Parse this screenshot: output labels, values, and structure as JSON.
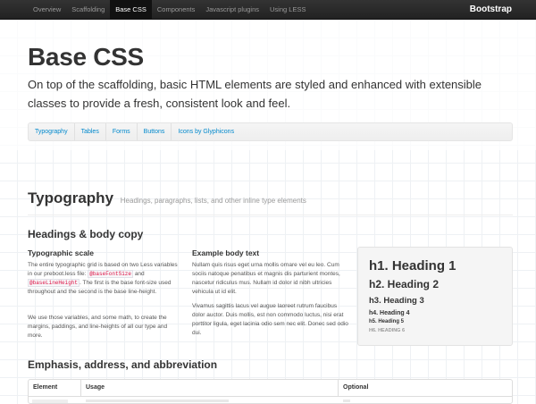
{
  "navbar": {
    "items": [
      "Overview",
      "Scaffolding",
      "Base CSS",
      "Components",
      "Javascript plugins",
      "Using LESS"
    ],
    "active_index": 2,
    "brand": "Bootstrap"
  },
  "header": {
    "title": "Base CSS",
    "lead": "On top of the scaffolding, basic HTML elements are styled and enhanced with extensible classes to provide a fresh, consistent look and feel."
  },
  "subnav": {
    "items": [
      "Typography",
      "Tables",
      "Forms",
      "Buttons",
      "Icons by Glyphicons"
    ]
  },
  "typography": {
    "title": "Typography",
    "subtitle": "Headings, paragraphs, lists, and other inline type elements",
    "headings_title": "Headings & body copy",
    "scale": {
      "title": "Typographic scale",
      "p1_before": "The entire typographic grid is based on two Less variables in our preboot.less file: ",
      "code1": "@baseFontSize",
      "p1_and": " and ",
      "code2": "@baseLineHeight",
      "p1_after": ". The first is the base font-size used throughout and the second is the base line-height.",
      "p2": "We use those variables, and some math, to create the margins, paddings, and line-heights of all our type and more."
    },
    "example": {
      "title": "Example body text",
      "p1": "Nullam quis risus eget urna mollis ornare vel eu leo. Cum sociis natoque penatibus et magnis dis parturient montes, nascetur ridiculus mus. Nullam id dolor id nibh ultricies vehicula ut id elit.",
      "p2": "Vivamus sagittis lacus vel augue laoreet rutrum faucibus dolor auctor. Duis mollis, est non commodo luctus, nisi erat porttitor ligula, eget lacinia odio sem nec elit. Donec sed odio dui."
    },
    "well": {
      "h1": "h1. Heading 1",
      "h2": "h2. Heading 2",
      "h3": "h3. Heading 3",
      "h4": "h4. Heading 4",
      "h5": "h5. Heading 5",
      "h6": "h6. Heading 6"
    },
    "emphasis_title": "Emphasis, address, and abbreviation",
    "table_headers": [
      "Element",
      "Usage",
      "Optional"
    ]
  }
}
